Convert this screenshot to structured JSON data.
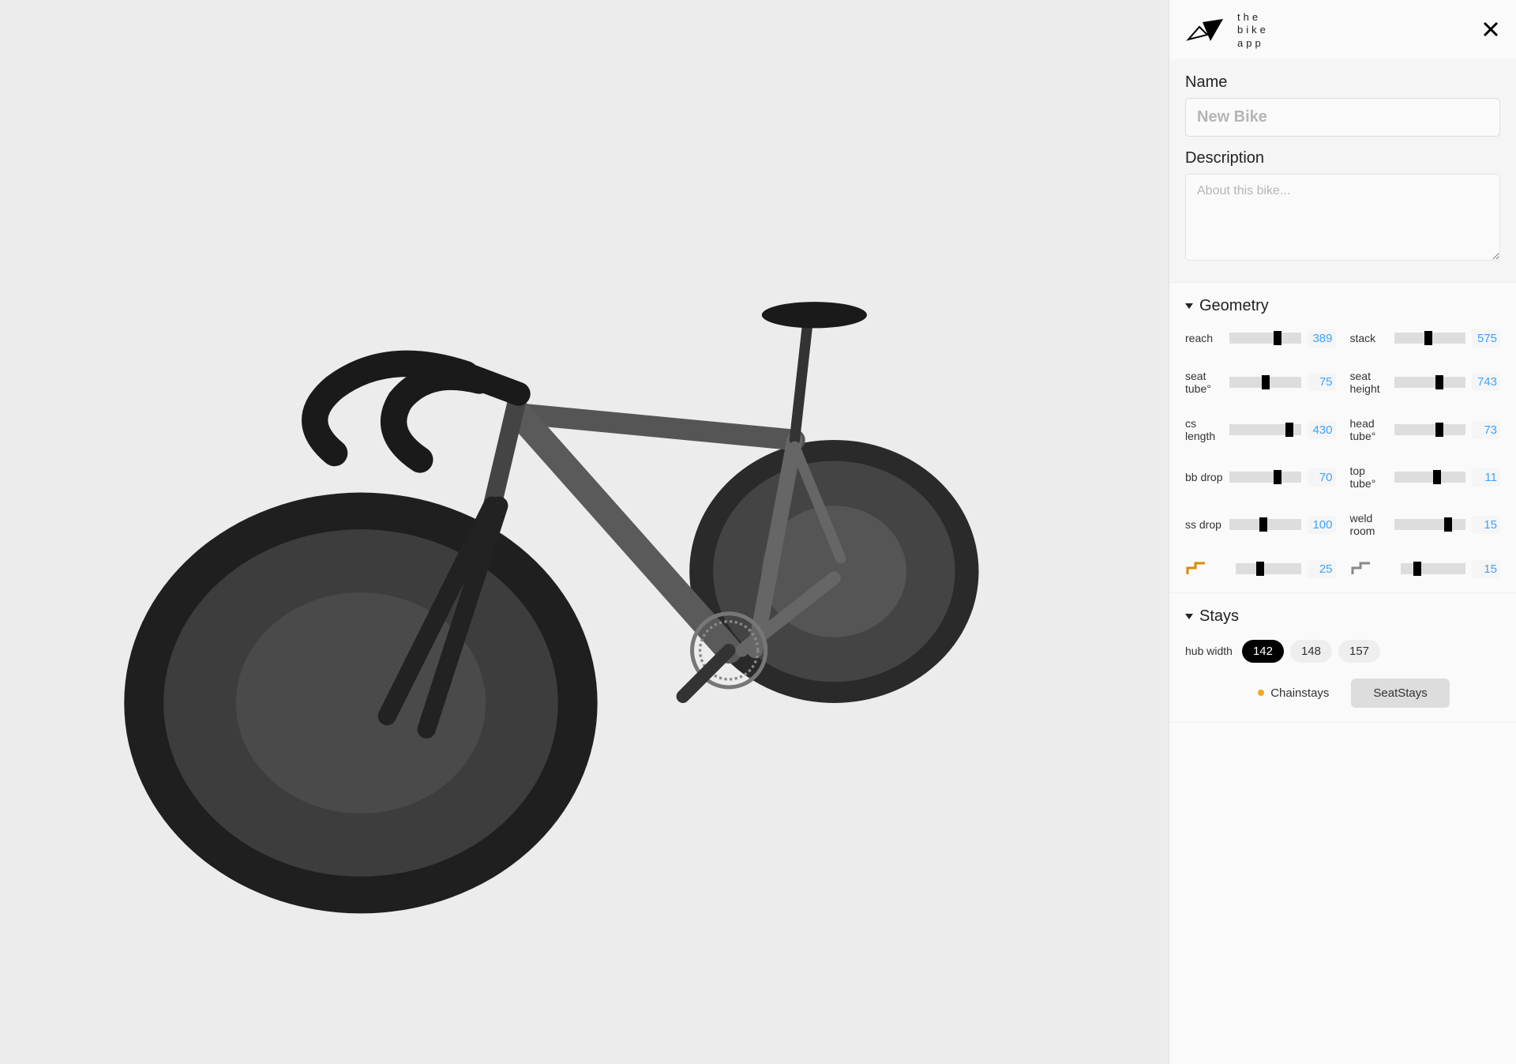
{
  "brand": {
    "line1": "the",
    "line2": "bike",
    "line3": "app"
  },
  "info": {
    "name_label": "Name",
    "name_placeholder": "New Bike",
    "description_label": "Description",
    "description_placeholder": "About this bike..."
  },
  "sections": {
    "geometry": {
      "title": "Geometry",
      "params": [
        {
          "label": "reach",
          "value": "389",
          "pos": 0.62
        },
        {
          "label": "stack",
          "value": "575",
          "pos": 0.42
        },
        {
          "label": "seat tube°",
          "value": "75",
          "pos": 0.45
        },
        {
          "label": "seat height",
          "value": "743",
          "pos": 0.58
        },
        {
          "label": "cs length",
          "value": "430",
          "pos": 0.78
        },
        {
          "label": "head tube°",
          "value": "73",
          "pos": 0.58
        },
        {
          "label": "bb drop",
          "value": "70",
          "pos": 0.62
        },
        {
          "label": "top tube°",
          "value": "11",
          "pos": 0.55
        },
        {
          "label": "ss drop",
          "value": "100",
          "pos": 0.42
        },
        {
          "label": "weld room",
          "value": "15",
          "pos": 0.7
        },
        {
          "icon": "step-orange",
          "value": "25",
          "pos": 0.32
        },
        {
          "icon": "step-gray",
          "value": "15",
          "pos": 0.2
        }
      ]
    },
    "stays": {
      "title": "Stays",
      "hub_label": "hub width",
      "hub_options": [
        {
          "value": "142",
          "active": true
        },
        {
          "value": "148",
          "active": false
        },
        {
          "value": "157",
          "active": false
        }
      ],
      "tabs": [
        {
          "label": "Chainstays",
          "active": true,
          "dot": true
        },
        {
          "label": "SeatStays",
          "active": false,
          "dot": false
        }
      ]
    }
  }
}
